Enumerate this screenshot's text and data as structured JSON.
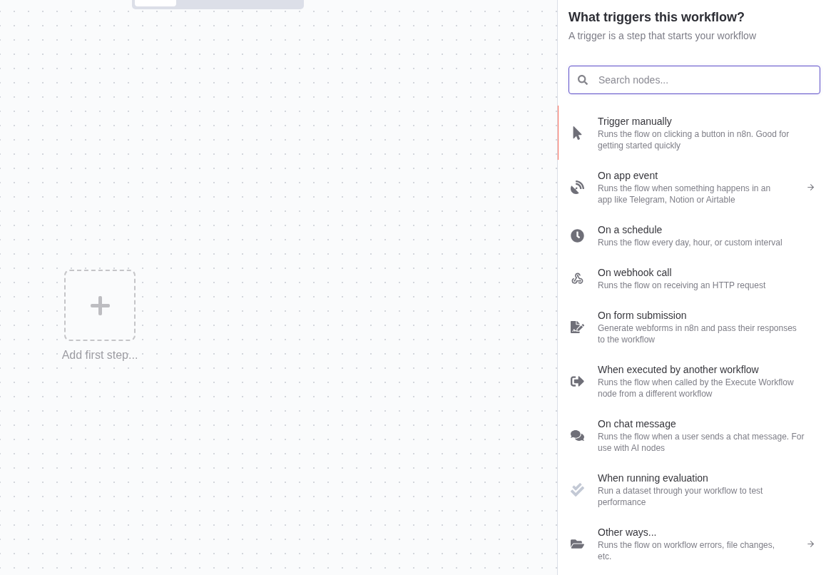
{
  "canvas": {
    "view_tabs": [
      {
        "selected": true
      },
      {
        "selected": false
      },
      {
        "selected": false
      }
    ],
    "add_step": {
      "label": "Add first step..."
    }
  },
  "panel": {
    "title": "What triggers this workflow?",
    "subtitle": "A trigger is a step that starts your workflow",
    "search": {
      "placeholder": "Search nodes...",
      "focused": true
    },
    "items": [
      {
        "title": "Trigger manually",
        "description": "Runs the flow on clicking a button in n8n. Good for getting started quickly",
        "selected": true,
        "has_submenu": false
      },
      {
        "title": "On app event",
        "description": "Runs the flow when something happens in an app like Telegram, Notion or Airtable",
        "selected": false,
        "has_submenu": true
      },
      {
        "title": "On a schedule",
        "description": "Runs the flow every day, hour, or custom interval",
        "selected": false,
        "has_submenu": false
      },
      {
        "title": "On webhook call",
        "description": "Runs the flow on receiving an HTTP request",
        "selected": false,
        "has_submenu": false
      },
      {
        "title": "On form submission",
        "description": "Generate webforms in n8n and pass their responses to the workflow",
        "selected": false,
        "has_submenu": false
      },
      {
        "title": "When executed by another workflow",
        "description": "Runs the flow when called by the Execute Workflow node from a different workflow",
        "selected": false,
        "has_submenu": false
      },
      {
        "title": "On chat message",
        "description": "Runs the flow when a user sends a chat message. For use with AI nodes",
        "selected": false,
        "has_submenu": false
      },
      {
        "title": "When running evaluation",
        "description": "Run a dataset through your workflow to test performance",
        "selected": false,
        "has_submenu": false
      },
      {
        "title": "Other ways...",
        "description": "Runs the flow on workflow errors, file changes, etc.",
        "selected": false,
        "has_submenu": true
      }
    ]
  }
}
